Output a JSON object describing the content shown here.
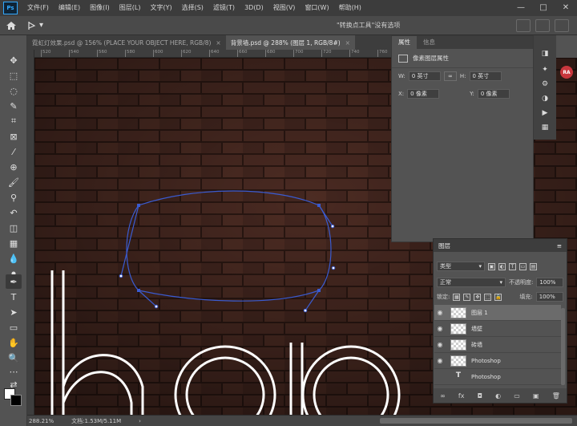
{
  "app": {
    "logo": "Ps"
  },
  "menu": [
    "文件(F)",
    "编辑(E)",
    "图像(I)",
    "图层(L)",
    "文字(Y)",
    "选择(S)",
    "滤镜(T)",
    "3D(D)",
    "视图(V)",
    "窗口(W)",
    "帮助(H)"
  ],
  "window_controls": [
    "—",
    "□",
    "✕"
  ],
  "options_bar": {
    "tool_preset": "▾",
    "title": "\"转换点工具\"没有选项"
  },
  "tabs": [
    {
      "label": "霓虹灯效果.psd @ 156% (PLACE YOUR OBJECT HERE, RGB/8)",
      "close": "×",
      "active": false
    },
    {
      "label": "背景墙.psd @ 288% (图层 1, RGB/8#)",
      "close": "×",
      "active": true
    }
  ],
  "ruler": {
    "ticks": [
      "520",
      "540",
      "560",
      "580",
      "600",
      "620",
      "640",
      "660",
      "680",
      "700",
      "720",
      "740",
      "760"
    ]
  },
  "canvas": {
    "text": "hop",
    "brick_color": "#4a2a22",
    "mortar_color": "#2a1712",
    "path_color": "#3a5bd0"
  },
  "status": {
    "zoom": "288.21%",
    "doc": "文档:1.53M/5.11M",
    "arrow": "›"
  },
  "properties": {
    "tabs": [
      "属性",
      "信息"
    ],
    "header": "像素图层属性",
    "w_label": "W:",
    "w_value": "0 英寸",
    "h_label": "H:",
    "h_value": "0 英寸",
    "x_label": "X:",
    "x_value": "0 像素",
    "y_label": "Y:",
    "y_value": "0 像素",
    "link": "∞"
  },
  "icon_strip": {
    "avatar": "RA"
  },
  "layers": {
    "title": "图层",
    "menu": "≡",
    "filter": "类型",
    "blend_mode": "正常",
    "opacity_label": "不透明度:",
    "opacity": "100%",
    "lock_label": "锁定:",
    "fill_label": "填充:",
    "fill": "100%",
    "items": [
      {
        "name": "图层 1",
        "visible": true,
        "selected": true,
        "thumb": "pixel"
      },
      {
        "name": "墙壁",
        "visible": true,
        "selected": false,
        "thumb": "pixel"
      },
      {
        "name": "砖墙",
        "visible": true,
        "selected": false,
        "thumb": "pixel"
      },
      {
        "name": "Photoshop",
        "visible": true,
        "selected": false,
        "thumb": "pixel"
      },
      {
        "name": "Photoshop",
        "visible": false,
        "selected": false,
        "thumb": "type"
      }
    ],
    "footer": [
      "∞",
      "fx",
      "◘",
      "◐",
      "▭",
      "▣",
      "🗑"
    ]
  }
}
